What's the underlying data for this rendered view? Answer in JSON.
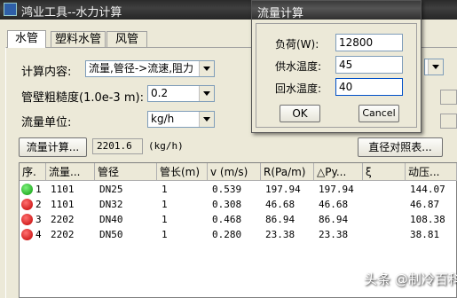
{
  "window": {
    "title": "鸿业工具--水力计算"
  },
  "tabs": [
    {
      "label": "水管"
    },
    {
      "label": "塑料水管"
    },
    {
      "label": "风管"
    }
  ],
  "form": {
    "calc_content_label": "计算内容:",
    "calc_content_value": "流量,管径->流速,阻力",
    "roughness_label": "管壁粗糙度(1.0e-3 m):",
    "roughness_value": "0.2",
    "flow_unit_label": "流量单位:",
    "flow_unit_value": "kg/h",
    "flow_calc_button": "流量计算...",
    "flow_result_value": "2201.6",
    "flow_result_unit": "(kg/h)",
    "diameter_table_button": "直径对照表..."
  },
  "table": {
    "columns": [
      "序.",
      "流量...",
      "管径",
      "管长(m)",
      "v (m/s)",
      "R(Pa/m)",
      "△Py...",
      "ξ",
      "动压..."
    ],
    "rows": [
      {
        "status": "green",
        "no": "1",
        "flow": "1101",
        "dia": "DN25",
        "len": "1",
        "v": "0.539",
        "r": "197.94",
        "py": "197.94",
        "xi": "",
        "dyn": "144.07"
      },
      {
        "status": "red",
        "no": "2",
        "flow": "1101",
        "dia": "DN32",
        "len": "1",
        "v": "0.308",
        "r": "46.68",
        "py": "46.68",
        "xi": "",
        "dyn": "46.87"
      },
      {
        "status": "red",
        "no": "3",
        "flow": "2202",
        "dia": "DN40",
        "len": "1",
        "v": "0.468",
        "r": "86.94",
        "py": "86.94",
        "xi": "",
        "dyn": "108.38"
      },
      {
        "status": "red",
        "no": "4",
        "flow": "2202",
        "dia": "DN50",
        "len": "1",
        "v": "0.280",
        "r": "23.38",
        "py": "23.38",
        "xi": "",
        "dyn": "38.81"
      }
    ]
  },
  "dialog": {
    "title": "流量计算",
    "load_label": "负荷(W):",
    "load_value": "12800",
    "supply_label": "供水温度:",
    "supply_value": "45",
    "return_label": "回水温度:",
    "return_value": "40",
    "ok": "OK",
    "cancel": "Cancel"
  },
  "watermark": "头条 @制冷百科"
}
